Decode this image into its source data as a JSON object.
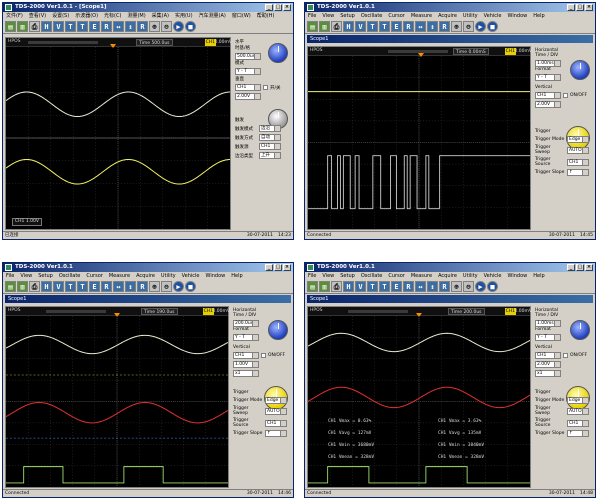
{
  "colors": {
    "titlebar": "#0a246a",
    "trace_ch1": "#ffffa0",
    "trace_ch2": "#c8ffa0",
    "trace_red": "#ff3030",
    "trigger": "#e8d000",
    "grid": "#3a3a3a"
  },
  "w1": {
    "title": "TDS-2000 Ver1.0.1 - [Scope1]",
    "menu": [
      "文件(F)",
      "查看(V)",
      "设置(S)",
      "示波器(O)",
      "光标(C)",
      "测量(M)",
      "采集(A)",
      "实用(U)",
      "汽车测量(A)",
      "窗口(W)",
      "帮助(H)"
    ],
    "tools": [
      "H",
      "V",
      "T",
      "T",
      "E",
      "R",
      "↔",
      "↕",
      "R"
    ],
    "scope_title": "",
    "time_label": "HPOS",
    "time_box": "Time 500.0us",
    "trig_box": "CH1",
    "trig_value": "0.00mV",
    "side": {
      "g1": "水平",
      "l1": "时基/格",
      "v1": "500.0us",
      "l2": "模式",
      "v2": "Y - T",
      "g2": "垂直",
      "v3": "CH1",
      "chk": "开/关",
      "v4": "2.00V",
      "g3": "触发",
      "r1l": "触发模式",
      "r1v": "边沿",
      "r2l": "触发方式",
      "r2v": "自动",
      "r3l": "触发源",
      "r3v": "CH1",
      "r4l": "边沿类型",
      "r4v": "上升"
    },
    "label_box": "CH1 1.00V",
    "status_left": "已连接",
    "status_date": "30-07-2011",
    "status_time": "14:23"
  },
  "w2": {
    "title": "TDS-2000 Ver1.0.1",
    "menu": [
      "File",
      "View",
      "Setup",
      "Oscillate",
      "Cursor",
      "Measure",
      "Acquire",
      "Utility",
      "Vehicle",
      "Window",
      "Help"
    ],
    "tools": [
      "H",
      "V",
      "T",
      "T",
      "E",
      "R",
      "↔",
      "↕",
      "R"
    ],
    "scope_title": "Scope1",
    "time_label": "HPOS",
    "time_box": "Time 0.00mS",
    "trig_box": "CH1",
    "trig_value": "0.00mV",
    "side": {
      "g1": "Horizontal",
      "l1": "Time / DIV",
      "v1": "1.00ms",
      "l2": "Format",
      "v2": "Y - T",
      "g2": "Vertical",
      "v3": "CH1",
      "chk": "ON/OFF",
      "v4": "2.00V",
      "g3": "Trigger",
      "r1l": "Trigger Mode",
      "r1v": "Edge",
      "r2l": "Trigger Sweep",
      "r2v": "AUTO",
      "r3l": "Trigger Source",
      "r3v": "CH1",
      "r4l": "Trigger Slope",
      "r4v": "↑"
    },
    "status_left": "Connected",
    "status_date": "30-07-2011",
    "status_time": "14:45"
  },
  "w3": {
    "title": "TDS-2000 Ver1.0.1",
    "menu": [
      "File",
      "View",
      "Setup",
      "Oscillate",
      "Cursor",
      "Measure",
      "Acquire",
      "Utility",
      "Vehicle",
      "Window",
      "Help"
    ],
    "tools": [
      "H",
      "V",
      "T",
      "T",
      "E",
      "R",
      "↔",
      "↕",
      "R"
    ],
    "scope_title": "Scope1",
    "time_label": "HPOS",
    "time_box": "Time 190.0us",
    "trig_box": "CH1",
    "trig_value": "0.00mV",
    "side": {
      "g1": "Horizontal",
      "l1": "Time / DIV",
      "v1": "200.0us",
      "l2": "Format",
      "v2": "Y - T",
      "g2": "Vertical",
      "v3": "CH1",
      "chk": "ON/OFF",
      "v4": "1.00V",
      "v5": "x1",
      "g3": "Trigger",
      "r1l": "Trigger Mode",
      "r1v": "Edge",
      "r2l": "Trigger Sweep",
      "r2v": "AUTO",
      "r3l": "Trigger Source",
      "r3v": "CH1",
      "r4l": "Trigger Slope",
      "r4v": "↑"
    },
    "status_left": "Connected",
    "status_date": "30-07-2011",
    "status_time": "14:46"
  },
  "w4": {
    "title": "TDS-2000 Ver1.0.1",
    "menu": [
      "File",
      "View",
      "Setup",
      "Oscillate",
      "Cursor",
      "Measure",
      "Acquire",
      "Utility",
      "Vehicle",
      "Window",
      "Help"
    ],
    "tools": [
      "H",
      "V",
      "T",
      "T",
      "E",
      "R",
      "↔",
      "↕",
      "R"
    ],
    "scope_title": "Scope1",
    "time_label": "HPOS",
    "time_box": "Time 200.0us",
    "trig_box": "CH1",
    "trig_value": "0.00mV",
    "side": {
      "g1": "Horizontal",
      "l1": "Time / DIV",
      "v1": "1.00ms",
      "l2": "Format",
      "v2": "Y - T",
      "g2": "Vertical",
      "v3": "CH1",
      "chk": "ON/OFF",
      "v4": "2.00V",
      "v5": "x1",
      "g3": "Trigger",
      "r1l": "Trigger Mode",
      "r1v": "Edge",
      "r2l": "Trigger Sweep",
      "r2v": "AUTO",
      "r3l": "Trigger Source",
      "r3v": "CH1",
      "r4l": "Trigger Slope",
      "r4v": "↑"
    },
    "meas": [
      "CH1 Vmax = 0.63%",
      "CH1 Vavg = 127mV",
      "CH1 Vmin = 3680mV",
      "CH1 Vmean = 328mV",
      "CH1 Vmax = 3.63%",
      "CH1 Vavg = 135mV",
      "CH1 Vmin = 3840mV",
      "CH1 Vmean = 328mV"
    ],
    "status_left": "Connected",
    "status_date": "30-07-2011",
    "status_time": "14:48"
  }
}
